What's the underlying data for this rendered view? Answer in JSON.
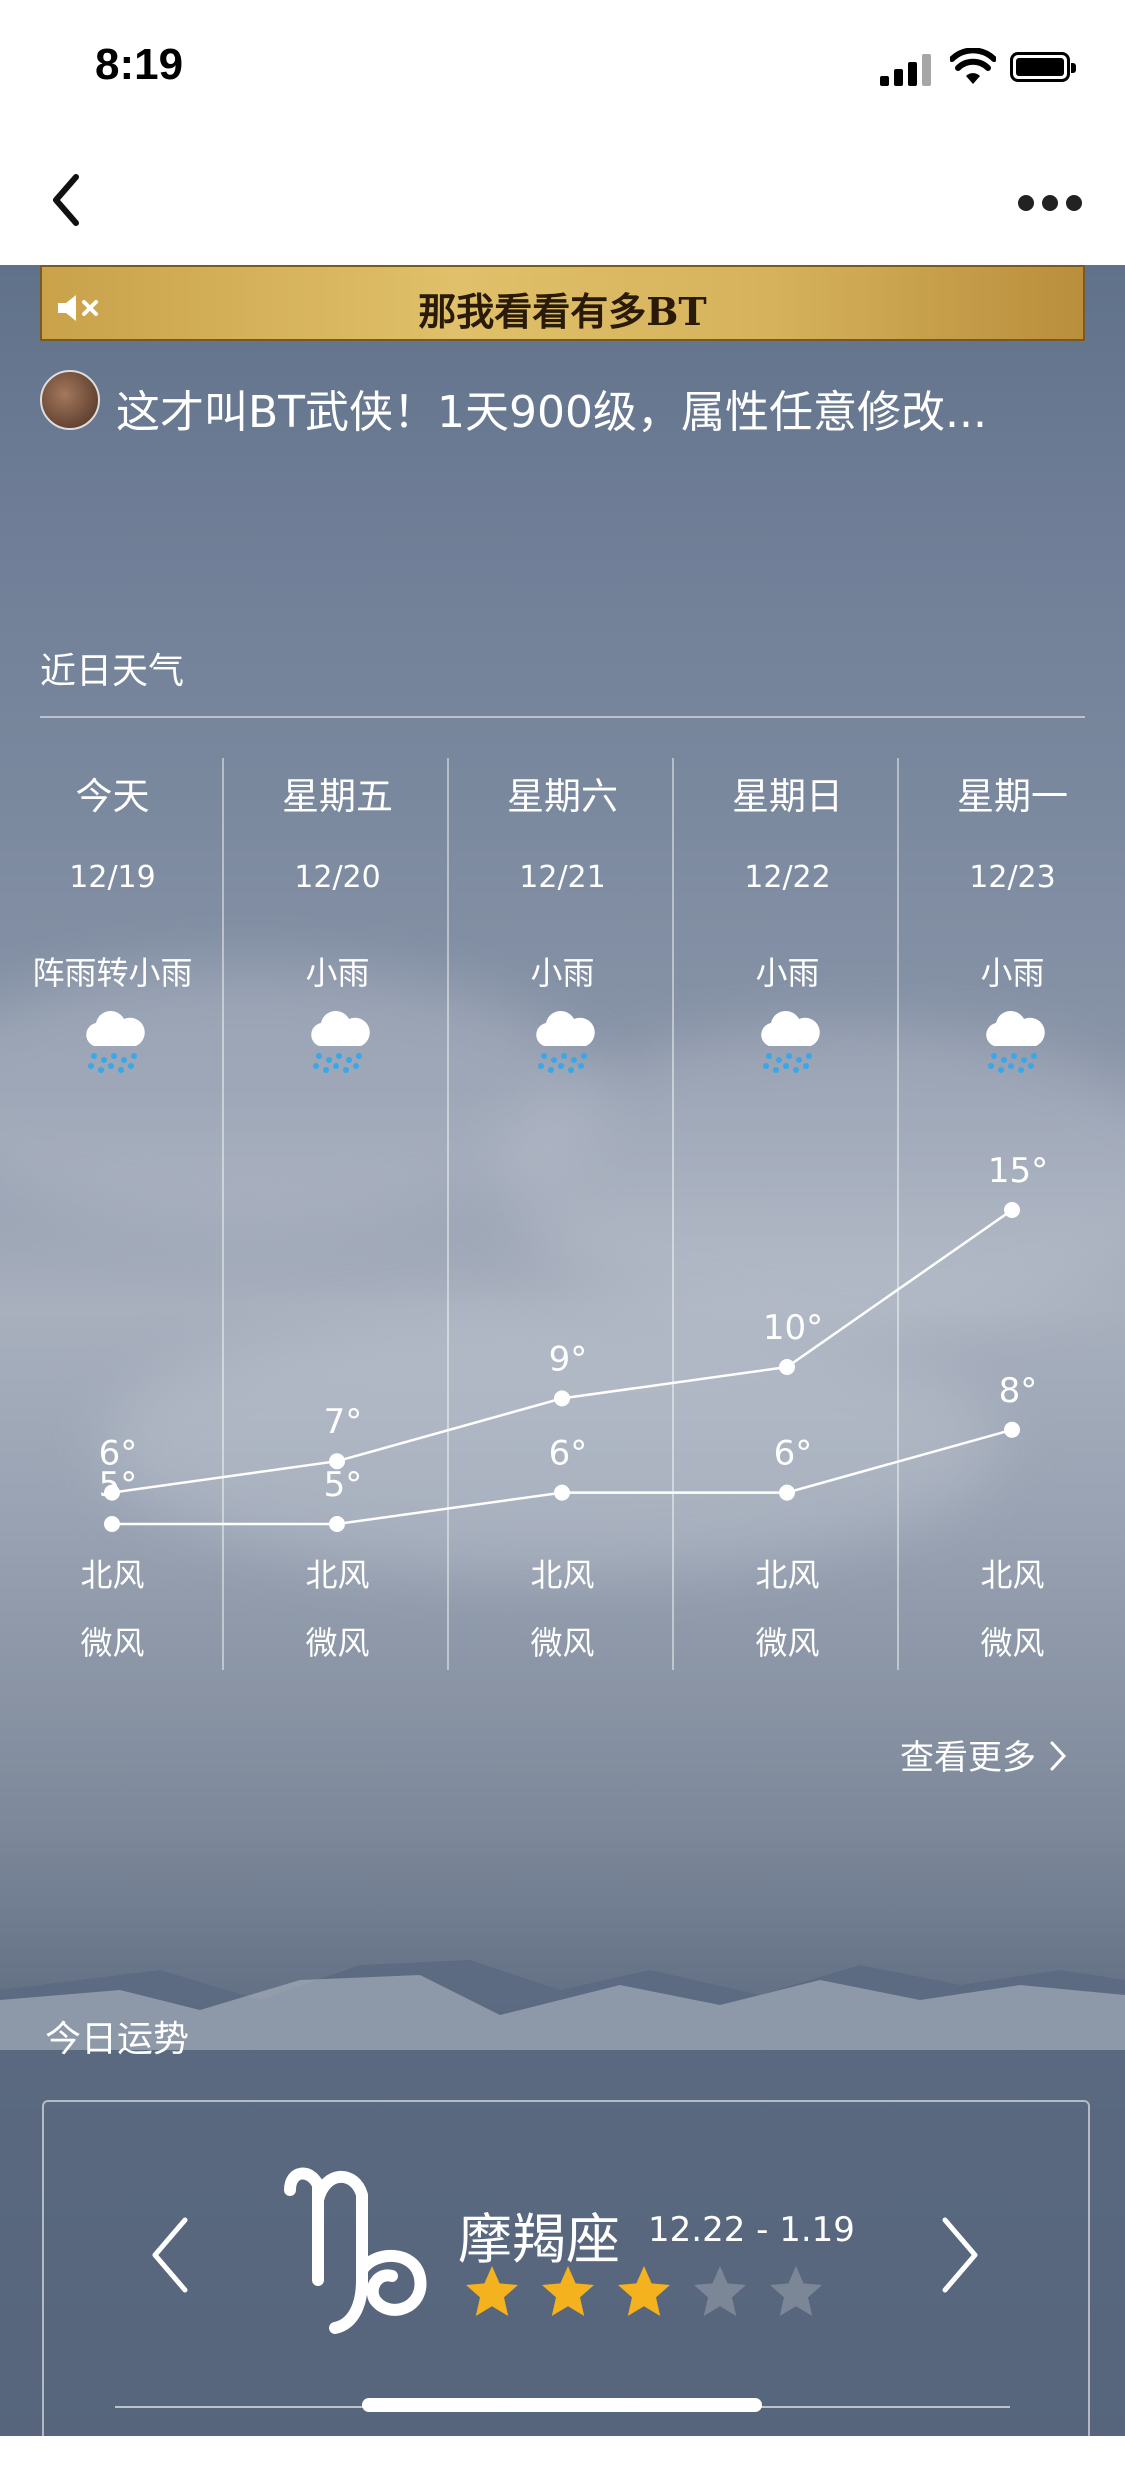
{
  "status_bar": {
    "time": "8:19"
  },
  "ad": {
    "banner_text": "那我看看有多BT",
    "title": "这才叫BT武侠！1天900级，属性任意修改..."
  },
  "forecast": {
    "section_title": "近日天气",
    "days": [
      {
        "day": "今天",
        "date": "12/19",
        "condition": "阵雨转小雨",
        "icon": "rain-cloud-icon",
        "high": "6°",
        "low": "5°",
        "wind_dir": "北风",
        "wind_level": "微风"
      },
      {
        "day": "星期五",
        "date": "12/20",
        "condition": "小雨",
        "icon": "rain-cloud-icon",
        "high": "7°",
        "low": "5°",
        "wind_dir": "北风",
        "wind_level": "微风"
      },
      {
        "day": "星期六",
        "date": "12/21",
        "condition": "小雨",
        "icon": "rain-cloud-icon",
        "high": "9°",
        "low": "6°",
        "wind_dir": "北风",
        "wind_level": "微风"
      },
      {
        "day": "星期日",
        "date": "12/22",
        "condition": "小雨",
        "icon": "rain-cloud-icon",
        "high": "10°",
        "low": "6°",
        "wind_dir": "北风",
        "wind_level": "微风"
      },
      {
        "day": "星期一",
        "date": "12/23",
        "condition": "小雨",
        "icon": "rain-cloud-icon",
        "high": "15°",
        "low": "8°",
        "wind_dir": "北风",
        "wind_level": "微风"
      }
    ],
    "more_link": "查看更多"
  },
  "chart_data": {
    "type": "line",
    "categories": [
      "12/19",
      "12/20",
      "12/21",
      "12/22",
      "12/23"
    ],
    "series": [
      {
        "values": [
          6,
          7,
          9,
          10,
          15
        ]
      },
      {
        "values": [
          5,
          5,
          6,
          6,
          8
        ]
      }
    ]
  },
  "fortune": {
    "section_title": "今日运势",
    "sign_name": "摩羯座",
    "date_range": "12.22 - 1.19",
    "rating": 3,
    "rating_max": 5
  },
  "colors": {
    "star_filled": "#f5b21f",
    "star_empty": "#7b8797",
    "rain_drops": "#3aa7e8"
  }
}
